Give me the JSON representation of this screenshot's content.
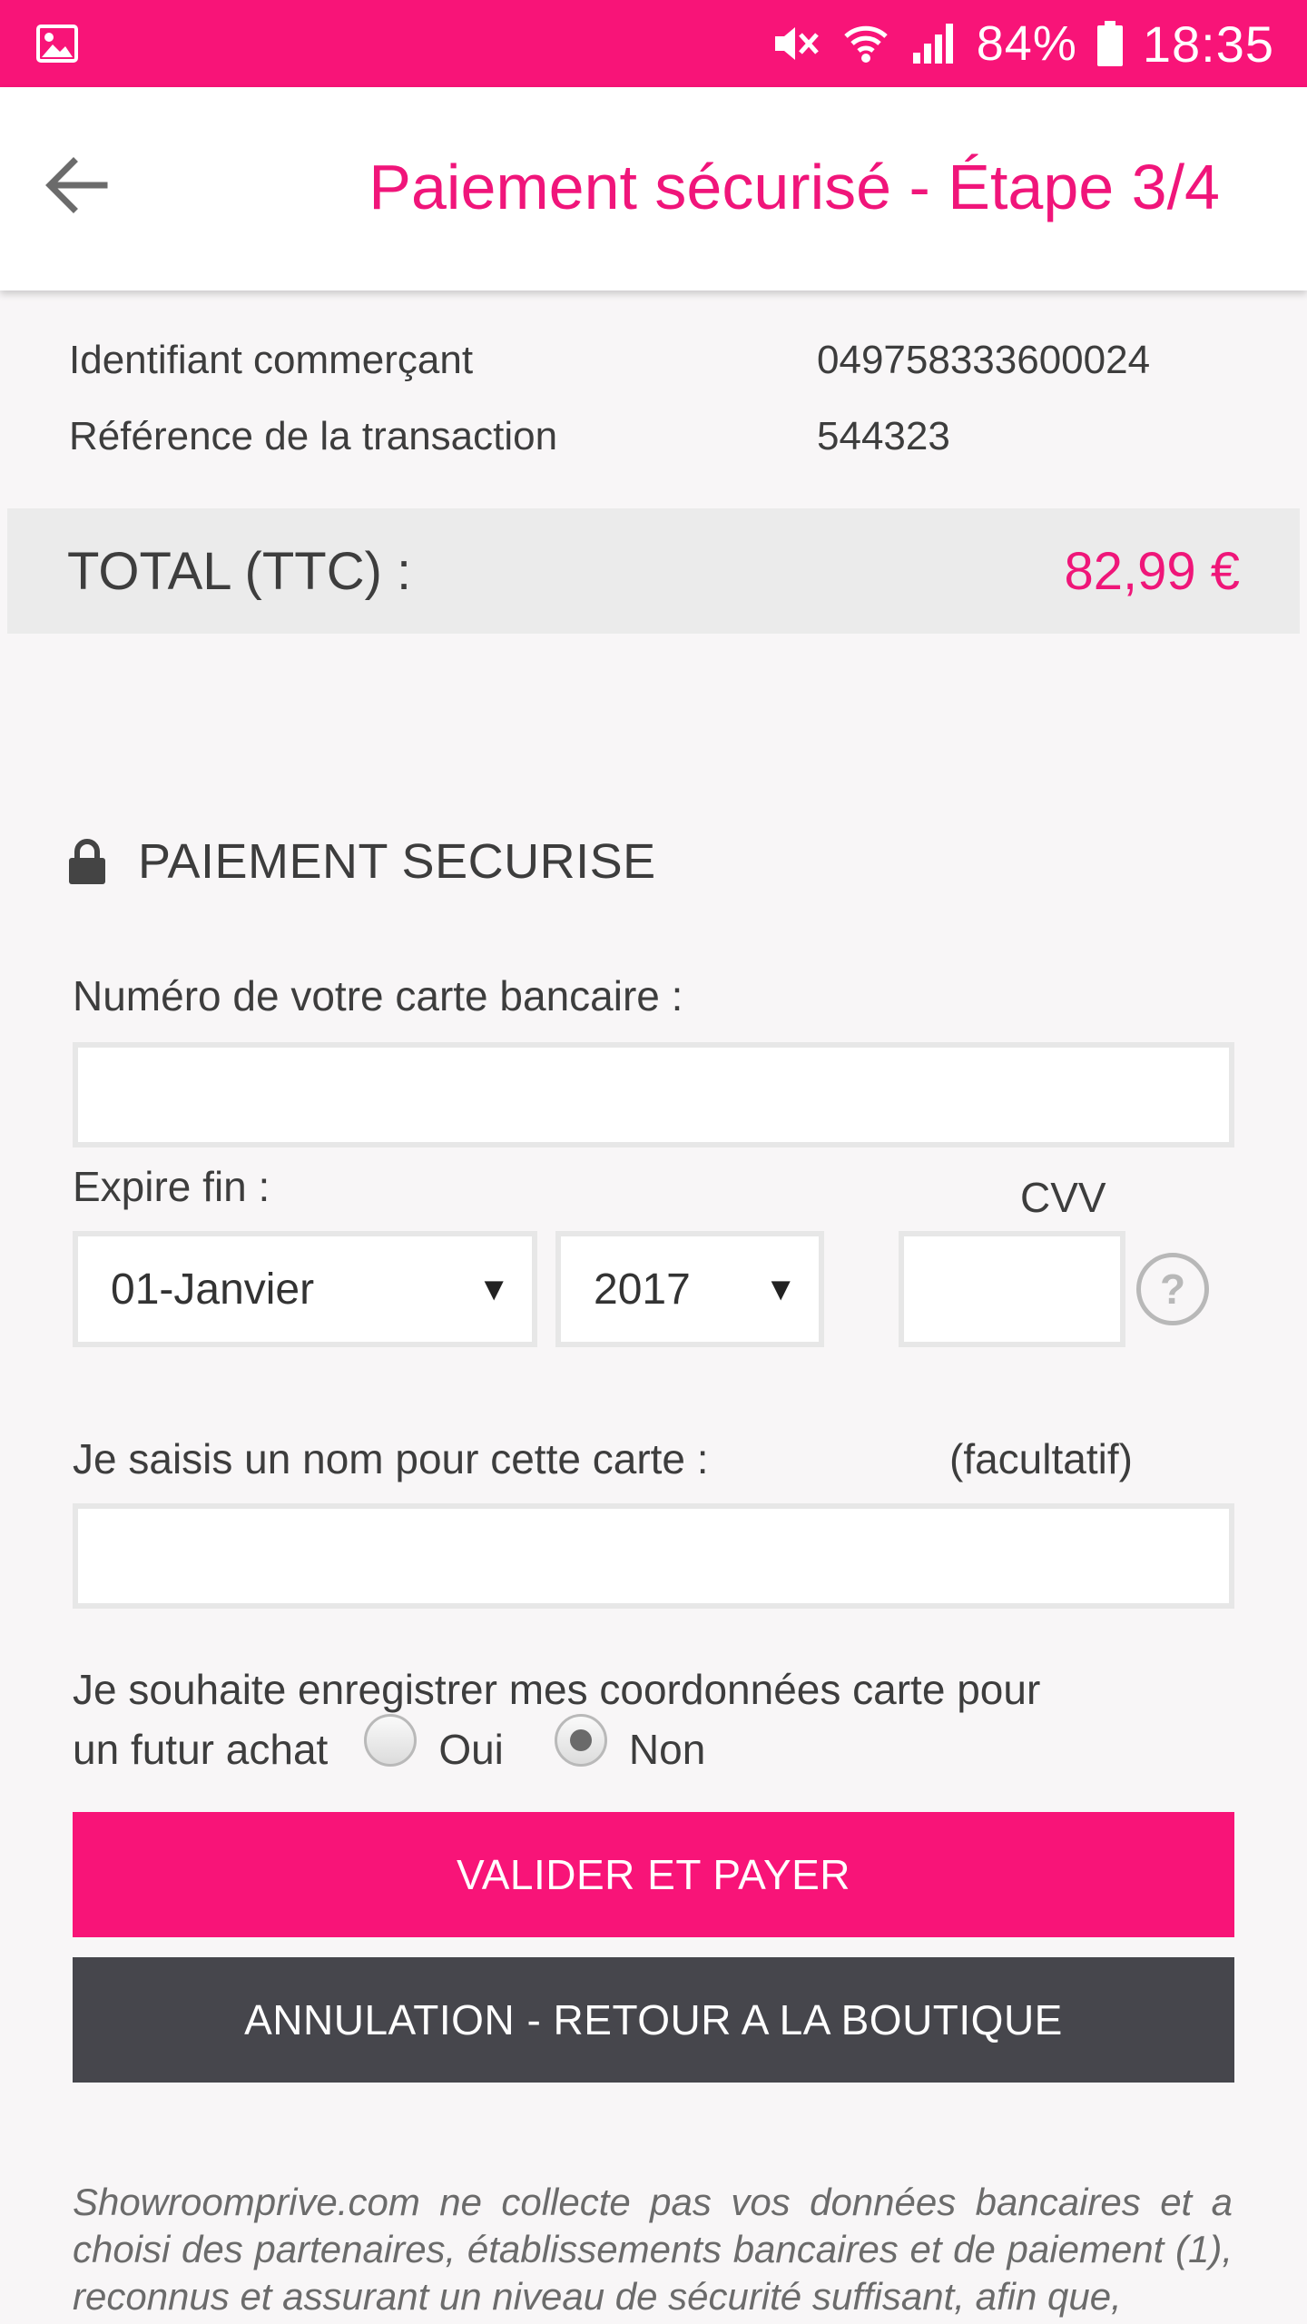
{
  "status_bar": {
    "battery": "84%",
    "time": "18:35"
  },
  "header": {
    "title": "Paiement sécurisé - Étape 3/4"
  },
  "merchant": {
    "id_label": "Identifiant commerçant",
    "id_value": "049758333600024",
    "ref_label": "Référence de la transaction",
    "ref_value": "544323"
  },
  "total": {
    "label": "TOTAL (TTC) :",
    "value": "82,99 €"
  },
  "payment": {
    "section_title": "PAIEMENT SECURISE",
    "card_number_label": "Numéro de votre carte bancaire :",
    "card_number_value": "",
    "expiry_label": "Expire fin :",
    "month_value": "01-Janvier",
    "year_value": "2017",
    "cvv_label": "CVV",
    "cvv_value": "",
    "help_glyph": "?",
    "card_name_label": "Je saisis un nom pour cette carte :",
    "optional_label": "(facultatif)",
    "card_name_value": "",
    "save_question_line1": "Je souhaite enregistrer mes coordonnées carte pour",
    "save_question_line2": "un futur achat",
    "option_yes": "Oui",
    "option_no": "Non",
    "selected_option": "Non"
  },
  "buttons": {
    "pay": "VALIDER ET PAYER",
    "cancel": "ANNULATION - RETOUR A LA BOUTIQUE"
  },
  "disclaimer": "Showroomprive.com ne collecte pas vos données bancaires et a choisi des partenaires, établissements bancaires et de paiement (1), reconnus et assurant un niveau de sécurité suffisant, afin que,",
  "colors": {
    "brand_pink": "#f81478",
    "dark_button": "#46464c"
  }
}
